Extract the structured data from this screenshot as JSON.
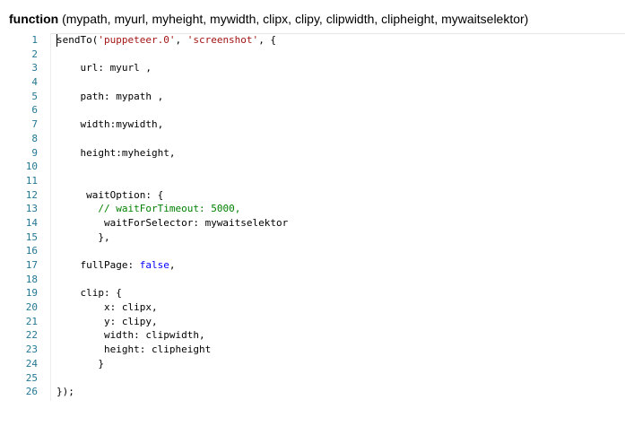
{
  "header": {
    "keyword": "function",
    "params": " (mypath, myurl, myheight, mywidth, clipx, clipy, clipwidth, clipheight, mywaitselektor)"
  },
  "editor": {
    "lines": [
      {
        "n": "1",
        "indent": "",
        "tokens": [
          {
            "t": "sendTo("
          },
          {
            "t": "'puppeteer.0'",
            "c": "str"
          },
          {
            "t": ", "
          },
          {
            "t": "'screenshot'",
            "c": "str"
          },
          {
            "t": ", {"
          }
        ]
      },
      {
        "n": "2",
        "indent": "",
        "tokens": []
      },
      {
        "n": "3",
        "indent": "    ",
        "tokens": [
          {
            "t": "url: myurl ,"
          }
        ]
      },
      {
        "n": "4",
        "indent": "",
        "tokens": []
      },
      {
        "n": "5",
        "indent": "    ",
        "tokens": [
          {
            "t": "path: mypath ,"
          }
        ]
      },
      {
        "n": "6",
        "indent": "",
        "tokens": []
      },
      {
        "n": "7",
        "indent": "    ",
        "tokens": [
          {
            "t": "width:mywidth,"
          }
        ]
      },
      {
        "n": "8",
        "indent": "",
        "tokens": []
      },
      {
        "n": "9",
        "indent": "    ",
        "tokens": [
          {
            "t": "height:myheight,"
          }
        ]
      },
      {
        "n": "10",
        "indent": "",
        "tokens": []
      },
      {
        "n": "11",
        "indent": "",
        "tokens": []
      },
      {
        "n": "12",
        "indent": "     ",
        "tokens": [
          {
            "t": "waitOption: {"
          }
        ]
      },
      {
        "n": "13",
        "indent": "       ",
        "tokens": [
          {
            "t": "// waitForTimeout: ",
            "c": "cmt"
          },
          {
            "t": "5000",
            "c": "cmt"
          },
          {
            "t": ",",
            "c": "cmt"
          }
        ]
      },
      {
        "n": "14",
        "indent": "        ",
        "tokens": [
          {
            "t": "waitForSelector: mywaitselektor"
          }
        ]
      },
      {
        "n": "15",
        "indent": "       ",
        "tokens": [
          {
            "t": "},"
          }
        ]
      },
      {
        "n": "16",
        "indent": "",
        "tokens": []
      },
      {
        "n": "17",
        "indent": "    ",
        "tokens": [
          {
            "t": "fullPage: "
          },
          {
            "t": "false",
            "c": "kwc"
          },
          {
            "t": ","
          }
        ]
      },
      {
        "n": "18",
        "indent": "",
        "tokens": []
      },
      {
        "n": "19",
        "indent": "    ",
        "tokens": [
          {
            "t": "clip: {"
          }
        ]
      },
      {
        "n": "20",
        "indent": "        ",
        "tokens": [
          {
            "t": "x: clipx,"
          }
        ]
      },
      {
        "n": "21",
        "indent": "        ",
        "tokens": [
          {
            "t": "y: clipy,"
          }
        ]
      },
      {
        "n": "22",
        "indent": "        ",
        "tokens": [
          {
            "t": "width: clipwidth,"
          }
        ]
      },
      {
        "n": "23",
        "indent": "        ",
        "tokens": [
          {
            "t": "height: clipheight"
          }
        ]
      },
      {
        "n": "24",
        "indent": "       ",
        "tokens": [
          {
            "t": "}"
          }
        ]
      },
      {
        "n": "25",
        "indent": "",
        "tokens": []
      },
      {
        "n": "26",
        "indent": "",
        "tokens": [
          {
            "t": "});"
          }
        ]
      }
    ]
  }
}
